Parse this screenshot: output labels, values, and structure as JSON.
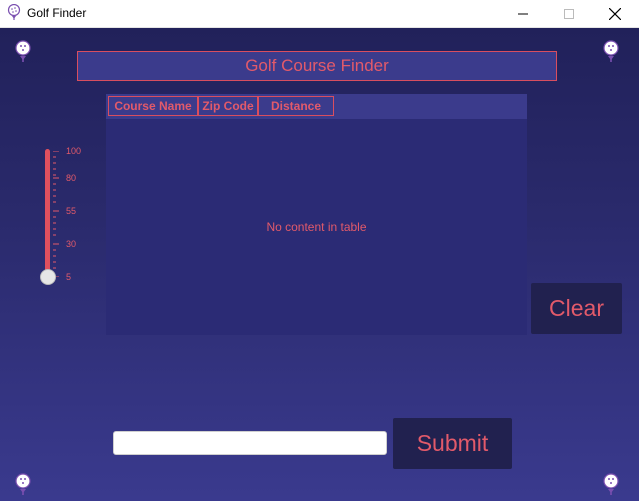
{
  "window": {
    "title": "Golf Finder",
    "app_icon": "golf-ball-icon",
    "controls": [
      "minimize-icon",
      "maximize-icon",
      "close-icon"
    ]
  },
  "header": {
    "title": "Golf Course Finder"
  },
  "slider": {
    "tick_labels": [
      "100",
      "80",
      "55",
      "30",
      "5"
    ],
    "min": 5,
    "max": 100,
    "value": 5,
    "accent": "#e0505e"
  },
  "table": {
    "columns": [
      "Course Name",
      "Zip Code",
      "Distance"
    ],
    "empty_message": "No content in table",
    "rows": []
  },
  "buttons": {
    "clear": "Clear",
    "submit": "Submit"
  },
  "search": {
    "value": "",
    "placeholder": ""
  },
  "colors": {
    "accent_text": "#e25a6a",
    "background_top": "#21215a",
    "background_bottom": "#3a3a8e",
    "button_bg": "#21214f"
  }
}
